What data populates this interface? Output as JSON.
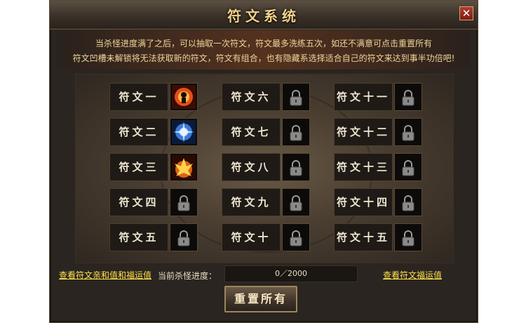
{
  "window": {
    "title": "符文系统",
    "close_label": "✕"
  },
  "notice": {
    "line1": "当杀怪进度满了之后，可以抽取一次符文，符文最多洗练五次，如还不满意可点击重置所有",
    "line2": "符文凹槽未解锁将无法获取新的符文，符文有组合，也有隐藏系选择适合自己的符文来达到事半功倍吧!"
  },
  "runes": [
    {
      "label": "符文一",
      "state": "fire-spirit",
      "color": "#e0501a"
    },
    {
      "label": "符文二",
      "state": "ice-burst",
      "color": "#3a7ad8"
    },
    {
      "label": "符文三",
      "state": "flame-burst",
      "color": "#d8641c"
    },
    {
      "label": "符文四",
      "state": "lock-icon"
    },
    {
      "label": "符文五",
      "state": "lock-icon"
    },
    {
      "label": "符文六",
      "state": "lock-icon"
    },
    {
      "label": "符文七",
      "state": "lock-icon"
    },
    {
      "label": "符文八",
      "state": "lock-icon"
    },
    {
      "label": "符文九",
      "state": "lock-icon"
    },
    {
      "label": "符文十",
      "state": "lock-icon"
    },
    {
      "label": "符文十一",
      "state": "lock-icon"
    },
    {
      "label": "符文十二",
      "state": "lock-icon"
    },
    {
      "label": "符文十三",
      "state": "lock-icon"
    },
    {
      "label": "符文十四",
      "state": "lock-icon"
    },
    {
      "label": "符文十五",
      "state": "lock-icon"
    }
  ],
  "footer": {
    "affinity_link": "查看符文亲和值和福运值",
    "progress_label": "当前杀怪进度：",
    "progress_text": "0／2000",
    "progress_fraction": 0,
    "fortune_link": "查看符文福运值",
    "reset_label": "重置所有"
  }
}
